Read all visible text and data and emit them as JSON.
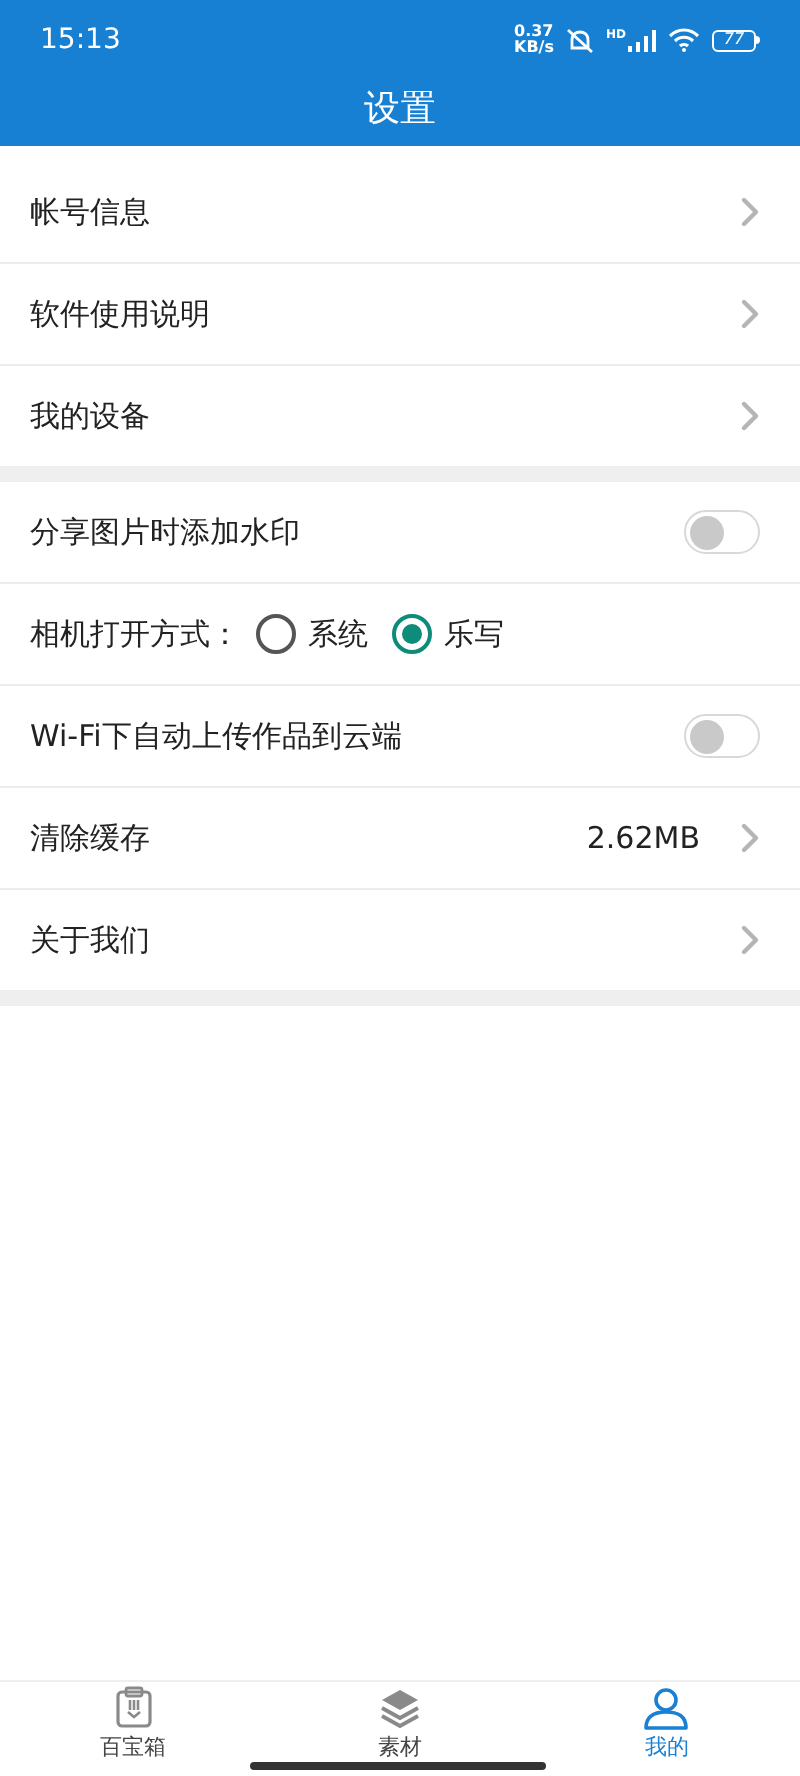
{
  "status_bar": {
    "time": "15:13",
    "speed_value": "0.37",
    "speed_unit": "KB/s",
    "network_badge": "HD",
    "battery": "77"
  },
  "title": "设置",
  "sections": [
    {
      "items": [
        {
          "kind": "link",
          "label": "帐号信息"
        },
        {
          "kind": "link",
          "label": "软件使用说明"
        },
        {
          "kind": "link",
          "label": "我的设备"
        }
      ]
    },
    {
      "items": [
        {
          "kind": "toggle",
          "label": "分享图片时添加水印",
          "on": false
        },
        {
          "kind": "radio",
          "label": "相机打开方式：",
          "options": [
            {
              "label": "系统",
              "selected": false
            },
            {
              "label": "乐写",
              "selected": true
            }
          ]
        },
        {
          "kind": "toggle",
          "label": "Wi-Fi下自动上传作品到云端",
          "on": false
        },
        {
          "kind": "link",
          "label": "清除缓存",
          "value": "2.62MB"
        },
        {
          "kind": "link",
          "label": "关于我们"
        }
      ]
    }
  ],
  "tabs": [
    {
      "kind": "toolbox",
      "label": "百宝箱",
      "selected": false
    },
    {
      "kind": "layers",
      "label": "素材",
      "selected": false
    },
    {
      "kind": "user",
      "label": "我的",
      "selected": true
    }
  ]
}
